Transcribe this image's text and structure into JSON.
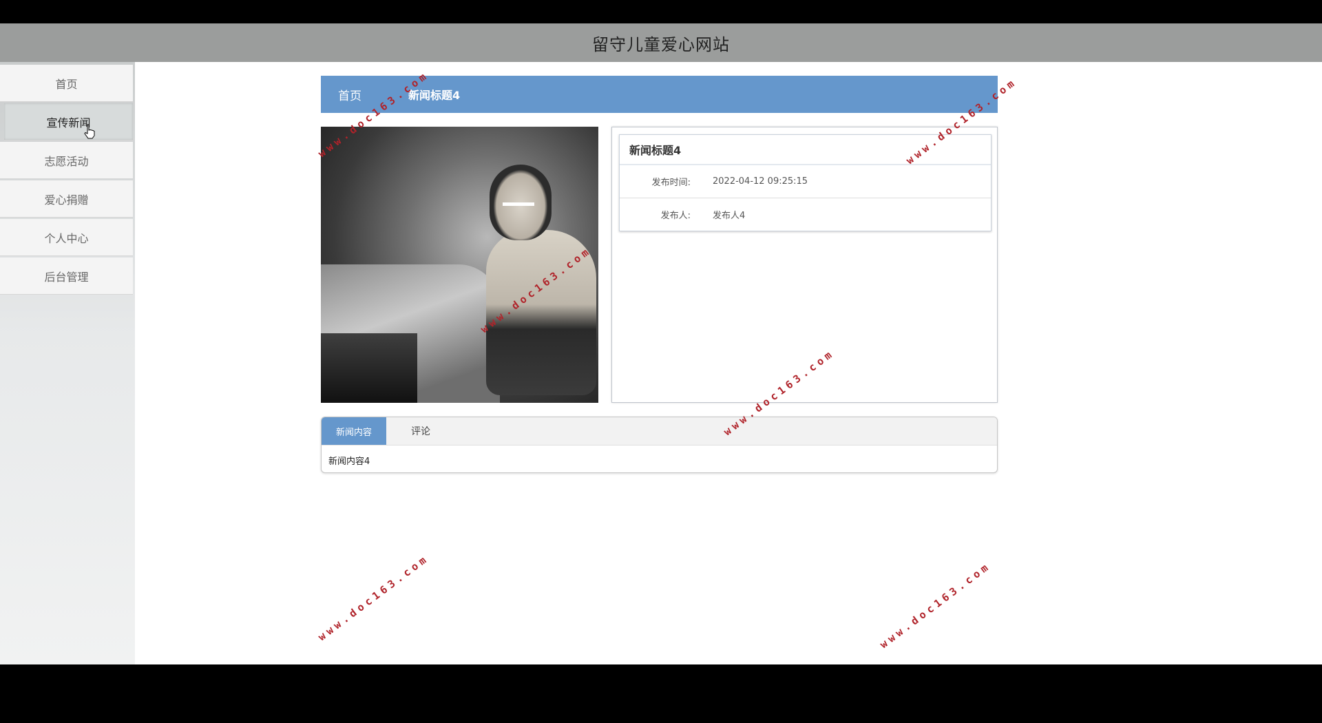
{
  "header": {
    "title": "留守儿童爱心网站"
  },
  "sidebar": {
    "items": [
      {
        "label": "首页",
        "active": false
      },
      {
        "label": "宣传新闻",
        "active": true
      },
      {
        "label": "志愿活动",
        "active": false
      },
      {
        "label": "爱心捐赠",
        "active": false
      },
      {
        "label": "个人中心",
        "active": false
      },
      {
        "label": "后台管理",
        "active": false
      }
    ]
  },
  "breadcrumb": {
    "home": "首页",
    "current": "新闻标题4"
  },
  "news": {
    "title": "新闻标题4",
    "publish_time_label": "发布时间:",
    "publish_time": "2022-04-12 09:25:15",
    "publisher_label": "发布人:",
    "publisher": "发布人4"
  },
  "tabs": {
    "items": [
      {
        "label": "新闻内容",
        "active": true
      },
      {
        "label": "评论",
        "active": false
      }
    ],
    "content": "新闻内容4"
  },
  "watermark": {
    "text": "www.doc163.com"
  },
  "colors": {
    "header": "#9b9d9c",
    "accent": "#6597cc",
    "watermark": "#b0232a"
  }
}
